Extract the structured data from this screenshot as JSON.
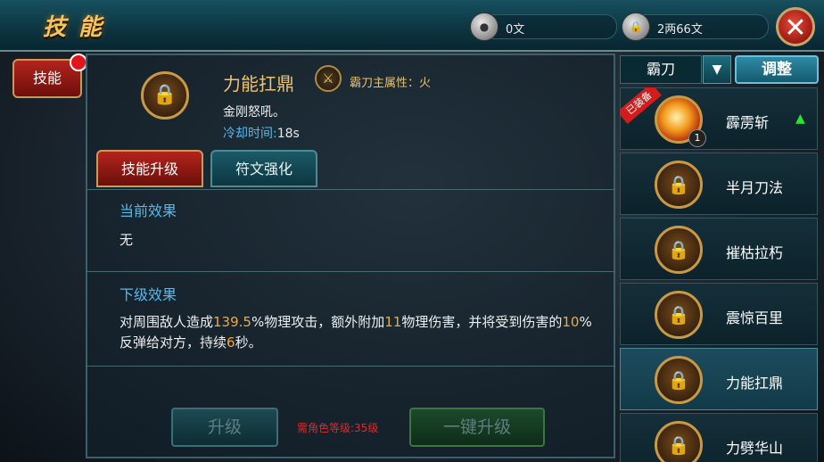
{
  "header": {
    "title": "技能",
    "close_glyph": "✕"
  },
  "currencies": [
    {
      "icon": "silver-coin-icon",
      "value": "0文"
    },
    {
      "icon": "locked-coin-icon",
      "value": "2两66文"
    }
  ],
  "side_tab": {
    "label": "技能",
    "has_notification": true
  },
  "skill": {
    "name": "力能扛鼎",
    "attribute": "霸刀主属性：火",
    "description": "金刚怒吼。",
    "cooldown_label": "冷却时间:",
    "cooldown_value": "18s"
  },
  "tabs": [
    {
      "label": "技能升级",
      "active": true
    },
    {
      "label": "符文强化",
      "active": false
    }
  ],
  "current_effect": {
    "title": "当前效果",
    "text": "无"
  },
  "next_effect": {
    "title": "下级效果",
    "parts": [
      "对周围敌人造成",
      "139.5",
      "%物理攻击，额外附加",
      "11",
      "物理伤害，并将受到伤害的",
      "10",
      "%反弹给对方，持续",
      "6",
      "秒。"
    ]
  },
  "buttons": {
    "upgrade": "升级",
    "one_click": "一键升级"
  },
  "requirement": "需角色等级:35级",
  "class_selector": {
    "value": "霸刀",
    "adjust": "调整"
  },
  "skill_list": [
    {
      "name": "霹雳斩",
      "level": "1",
      "equipped_tag": "已装备",
      "learned": true,
      "upgradable": true
    },
    {
      "name": "半月刀法",
      "learned": false
    },
    {
      "name": "摧枯拉朽",
      "learned": false
    },
    {
      "name": "震惊百里",
      "learned": false
    },
    {
      "name": "力能扛鼎",
      "learned": false,
      "selected": true
    },
    {
      "name": "力劈华山",
      "learned": false
    }
  ],
  "colors": {
    "accent_gold": "#f0c26a",
    "highlight": "#f2a93a",
    "blue_label": "#5ab7e8",
    "warning": "#e0282a"
  }
}
